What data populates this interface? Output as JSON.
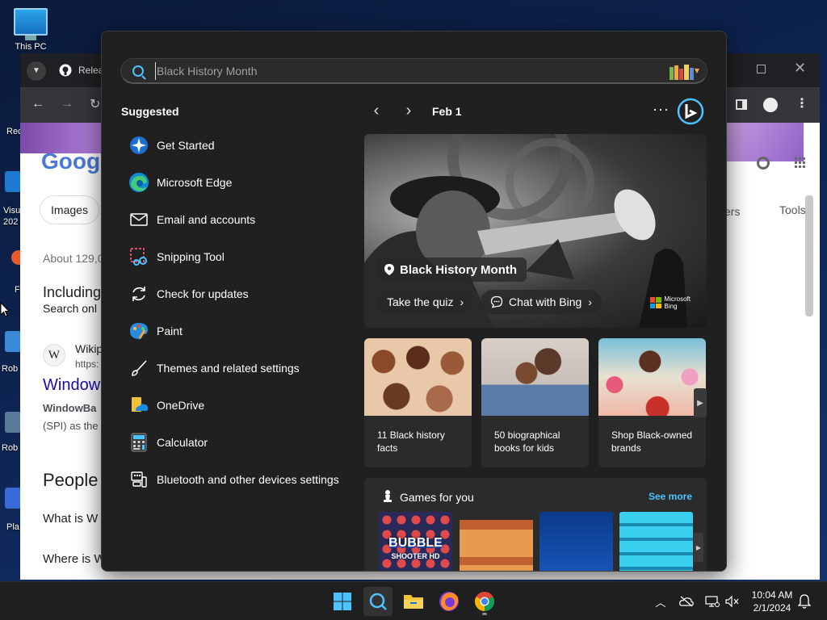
{
  "desktop": {
    "this_pc_label": "This PC",
    "partial_labels": [
      "Rec",
      "Visu",
      "202",
      "F",
      "Rob",
      "Rob",
      "Pla"
    ]
  },
  "browser": {
    "tab_label": "Relea",
    "page": {
      "logo_text": "Googl",
      "images_chip": "Images",
      "filters_partial": "ers",
      "tools": "Tools",
      "about": "About 129,0",
      "including": "Including",
      "search_only": "Search onl",
      "wiki_title": "Wikip",
      "wiki_url": "https:",
      "window_link": "Window",
      "windowba": "WindowBa",
      "spi": "(SPI) as the",
      "people": "People",
      "what_is": "What is W",
      "where_is": "Where is W"
    }
  },
  "start_menu": {
    "search": {
      "placeholder": "Black History Month",
      "value": ""
    },
    "suggested_title": "Suggested",
    "suggested": [
      {
        "label": "Get Started",
        "icon": "get-started-icon"
      },
      {
        "label": "Microsoft Edge",
        "icon": "edge-icon"
      },
      {
        "label": "Email and accounts",
        "icon": "mail-icon"
      },
      {
        "label": "Snipping Tool",
        "icon": "snipping-tool-icon"
      },
      {
        "label": "Check for updates",
        "icon": "refresh-icon"
      },
      {
        "label": "Paint",
        "icon": "paint-icon"
      },
      {
        "label": "Themes and related settings",
        "icon": "brush-icon"
      },
      {
        "label": "OneDrive",
        "icon": "onedrive-icon"
      },
      {
        "label": "Calculator",
        "icon": "calculator-icon"
      },
      {
        "label": "Bluetooth and other devices settings",
        "icon": "bluetooth-devices-icon"
      }
    ],
    "nav": {
      "date": "Feb 1",
      "more": "···"
    },
    "hero": {
      "title": "Black History Month",
      "quiz_button": "Take the quiz",
      "chat_button": "Chat with Bing",
      "brand_line1": "Microsoft",
      "brand_line2": "Bing"
    },
    "cards": [
      {
        "text": "11 Black history facts"
      },
      {
        "text": "50 biographical books for kids"
      },
      {
        "text": "Shop Black-owned brands"
      }
    ],
    "games": {
      "title": "Games for you",
      "see_more": "See more",
      "bubble_title": "BUBBLE",
      "bubble_sub": "SHOOTER HD"
    }
  },
  "taskbar": {
    "time": "10:04 AM",
    "date": "2/1/2024"
  },
  "colors": {
    "accent": "#4cc2ff",
    "menu_bg": "#202020",
    "card_bg": "#2b2b2b",
    "taskbar_bg": "#1f1f1f"
  }
}
